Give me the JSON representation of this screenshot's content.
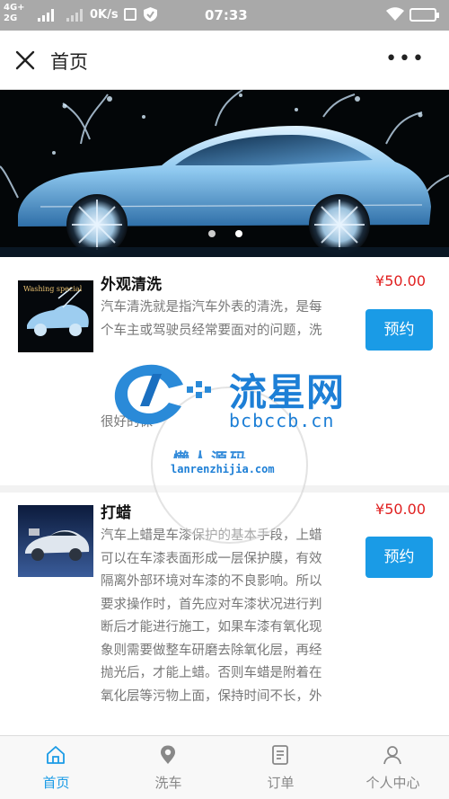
{
  "status_bar": {
    "network_top": "4G+",
    "network_bottom": "2G",
    "speed": "0K/s",
    "time": "07:33"
  },
  "header": {
    "title": "首页",
    "close_icon": "close-icon",
    "more_icon": "more-icon",
    "more_label": "•••"
  },
  "banner": {
    "image": "car-wash-banner",
    "slide_count": 2,
    "active_slide": 2
  },
  "services": [
    {
      "name": "外观清洗",
      "price": "¥50.00",
      "button": "预约",
      "desc_lines": [
        "汽车清洗就是指汽车外表的清洗，是每",
        "个车主或驾驶员经常要面对的问题，洗",
        "",
        "",
        "",
        "很好的保"
      ],
      "thumb_caption": "Washing special"
    },
    {
      "name": "打蜡",
      "price": "¥50.00",
      "button": "预约",
      "desc_lines": [
        "汽车上蜡是车漆保护的基本手段，上蜡",
        "可以在车漆表面形成一层保护膜，有效",
        "隔离外部环境对车漆的不良影响。所以",
        "要求操作时，首先应对车漆状况进行判",
        "断后才能进行施工，如果车漆有氧化现",
        "象则需要做整车研磨去除氧化层，再经",
        "抛光后，才能上蜡。否则车蜡是附着在",
        "氧化层等污物上面，保持时间不长，外"
      ]
    }
  ],
  "watermark": {
    "title": "流星网",
    "domain": "bcbccb.cn",
    "sub": "懒人源码",
    "url": "lanrenzhijia.com"
  },
  "tabbar": {
    "items": [
      {
        "label": "首页",
        "icon": "home-icon",
        "active": true
      },
      {
        "label": "洗车",
        "icon": "location-icon",
        "active": false
      },
      {
        "label": "订单",
        "icon": "order-icon",
        "active": false
      },
      {
        "label": "个人中心",
        "icon": "user-icon",
        "active": false
      }
    ]
  },
  "colors": {
    "accent": "#1a9be6",
    "price": "#e02020",
    "status_bar": "#a9a9a9"
  }
}
